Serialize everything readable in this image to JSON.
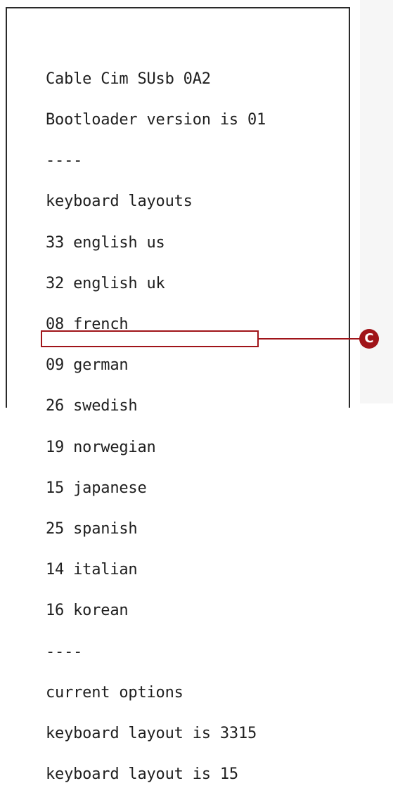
{
  "terminal": {
    "lines": [
      "Cable Cim SUsb 0A2",
      "Bootloader version is 01",
      "----",
      "keyboard layouts",
      "33 english us",
      "32 english uk",
      "08 french",
      "09 german",
      "26 swedish",
      "19 norwegian",
      "15 japanese",
      "25 spanish",
      "14 italian",
      "16 korean",
      "----",
      "current options",
      "keyboard layout is 3315",
      "keyboard layout is 15"
    ]
  },
  "callout": {
    "label": "C",
    "color": "#a01419"
  }
}
